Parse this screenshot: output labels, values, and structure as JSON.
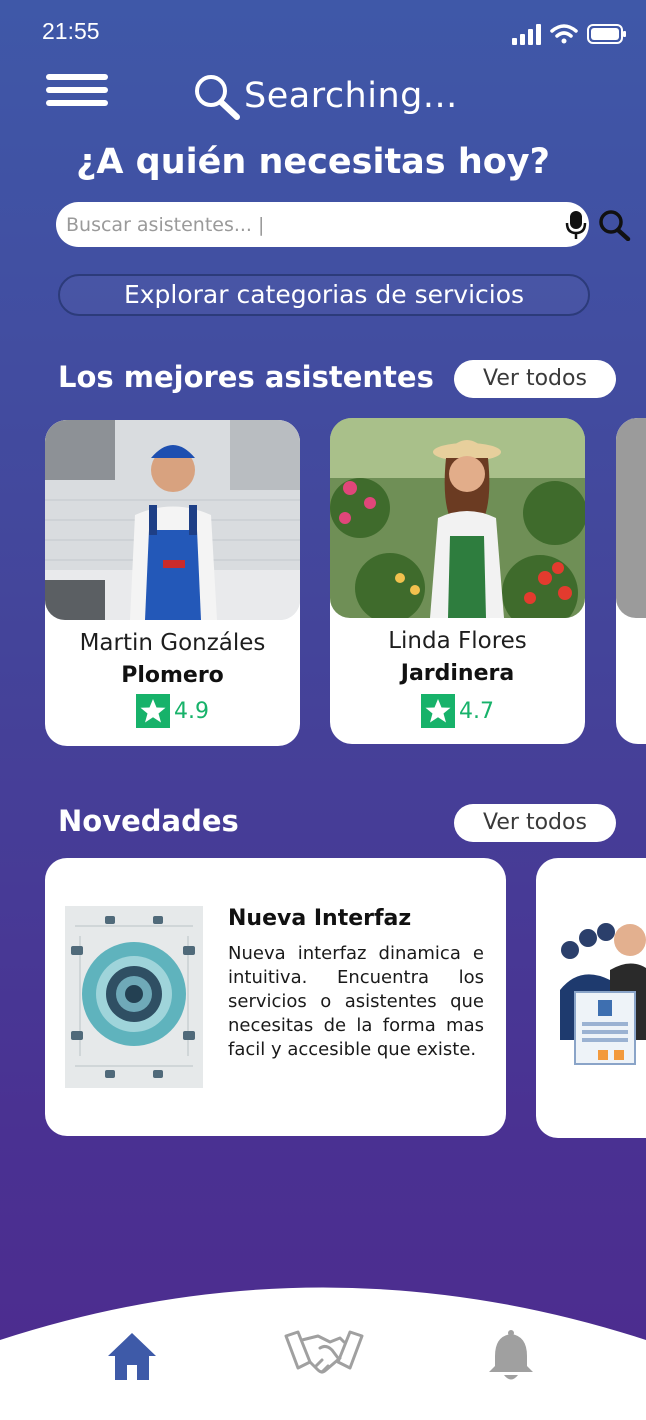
{
  "status": {
    "time": "21:55"
  },
  "header": {
    "brand": "Searching..."
  },
  "title": "¿A quién necesitas hoy?",
  "search": {
    "placeholder": "Buscar asistentes... |"
  },
  "explore_label": "Explorar categorias de servicios",
  "best": {
    "title": "Los mejores asistentes",
    "see_all": "Ver todos",
    "items": [
      {
        "name": "Martin Gonzáles",
        "role": "Plomero",
        "rating": "4.9"
      },
      {
        "name": "Linda Flores",
        "role": "Jardinera",
        "rating": "4.7"
      }
    ]
  },
  "news": {
    "title": "Novedades",
    "see_all": "Ver todos",
    "items": [
      {
        "title": "Nueva Interfaz",
        "body": "Nueva interfaz dinamica e intuitiva. Encuentra los servicios o asistentes que necesitas de la forma mas facil y accesible que existe."
      }
    ]
  },
  "colors": {
    "accent": "#3f58a8",
    "rating": "#17b26a",
    "nav_active": "#3e5aa8",
    "nav_inactive": "#9a9a9a"
  },
  "nav": [
    {
      "icon": "home-icon",
      "active": true
    },
    {
      "icon": "handshake-icon",
      "active": false
    },
    {
      "icon": "bell-icon",
      "active": false
    }
  ]
}
